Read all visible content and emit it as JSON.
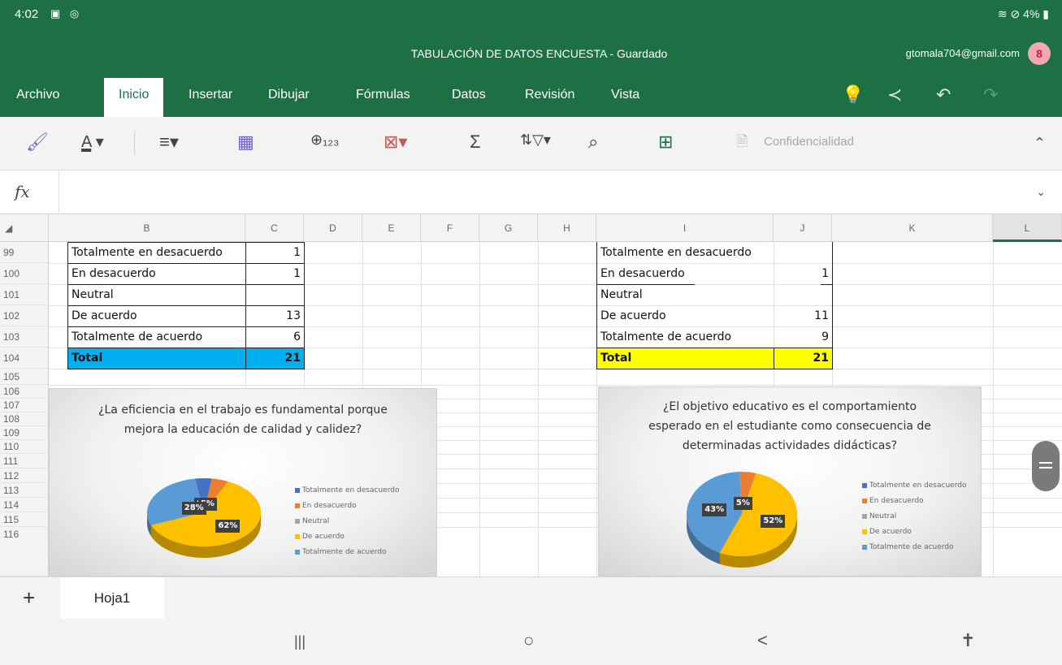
{
  "status": {
    "time": "4:02",
    "left_icons": "▣ ◎",
    "right": "≋ ⊘ 4% ▮"
  },
  "app": {
    "title": "TABULACIÓN DE DATOS ENCUESTA - Guardado",
    "account": "gtomala704@gmail.com",
    "avatar_letter": "8"
  },
  "menu": {
    "tabs": [
      "Archivo",
      "Inicio",
      "Insertar",
      "Dibujar",
      "Fórmulas",
      "Datos",
      "Revisión",
      "Vista"
    ],
    "active": "Inicio"
  },
  "toolbar": {
    "confidential_label": "Confidencialidad",
    "fx": "fx",
    "formula_value": ""
  },
  "columns": [
    "B",
    "C",
    "D",
    "E",
    "F",
    "G",
    "H",
    "I",
    "J",
    "K",
    "L"
  ],
  "rows": [
    "99",
    "100",
    "101",
    "102",
    "103",
    "104",
    "105",
    "106",
    "107",
    "108",
    "109",
    "110",
    "111",
    "112",
    "113",
    "114",
    "115",
    "116"
  ],
  "table1": {
    "rows": [
      {
        "label": "Totalmente en desacuerdo",
        "value": "1"
      },
      {
        "label": "En desacuerdo",
        "value": "1"
      },
      {
        "label": "Neutral",
        "value": ""
      },
      {
        "label": "De acuerdo",
        "value": "13"
      },
      {
        "label": "Totalmente de acuerdo",
        "value": "6"
      }
    ],
    "total_label": "Total",
    "total_value": "21",
    "total_color": "#00b0f0"
  },
  "table2": {
    "rows": [
      {
        "label": "Totalmente en desacuerdo",
        "value": ""
      },
      {
        "label": "En desacuerdo",
        "value": "1"
      },
      {
        "label": "Neutral",
        "value": ""
      },
      {
        "label": "De acuerdo",
        "value": "11"
      },
      {
        "label": "Totalmente de acuerdo",
        "value": "9"
      }
    ],
    "total_label": "Total",
    "total_value": "21",
    "total_color": "#ffff00"
  },
  "chart_data": [
    {
      "type": "pie",
      "title_lines": [
        "¿La eficiencia en el trabajo es fundamental porque",
        "mejora la educación de calidad y calidez?"
      ],
      "categories": [
        "Totalmente en desacuerdo",
        "En desacuerdo",
        "Neutral",
        "De acuerdo",
        "Totalmente de acuerdo"
      ],
      "values": [
        1,
        1,
        0,
        13,
        6
      ],
      "data_labels": [
        "5",
        "5%",
        "",
        "62%",
        "28%"
      ],
      "colors": [
        "#4472c4",
        "#ed7d31",
        "#a5a5a5",
        "#ffc000",
        "#5b9bd5"
      ],
      "legend": "right"
    },
    {
      "type": "pie",
      "title_lines": [
        "¿El objetivo educativo es el comportamiento",
        "esperado en el estudiante como consecuencia de",
        "determinadas actividades didácticas?"
      ],
      "categories": [
        "Totalmente en desacuerdo",
        "En desacuerdo",
        "Neutral",
        "De acuerdo",
        "Totalmente de acuerdo"
      ],
      "values": [
        0,
        1,
        0,
        11,
        9
      ],
      "data_labels": [
        "",
        "5%",
        "",
        "52%",
        "43%"
      ],
      "colors": [
        "#4472c4",
        "#ed7d31",
        "#a5a5a5",
        "#ffc000",
        "#5b9bd5"
      ],
      "legend": "right"
    }
  ],
  "sheets": [
    "Hoja1"
  ],
  "nav": {
    "recents": "|||",
    "home": "○",
    "back": "<",
    "accessibility": "✝"
  }
}
